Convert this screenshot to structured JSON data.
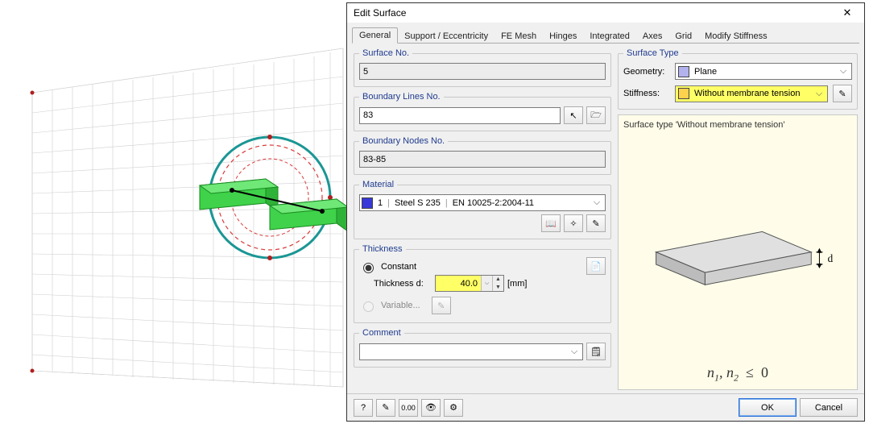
{
  "dialog": {
    "title": "Edit Surface",
    "close_glyph": "✕"
  },
  "tabs": {
    "items": [
      "General",
      "Support / Eccentricity",
      "FE Mesh",
      "Hinges",
      "Integrated",
      "Axes",
      "Grid",
      "Modify Stiffness"
    ],
    "active_index": 0
  },
  "groups": {
    "surface_no": {
      "legend": "Surface No.",
      "value": "5"
    },
    "boundary_lines": {
      "legend": "Boundary Lines No.",
      "value": "83"
    },
    "boundary_nodes": {
      "legend": "Boundary Nodes No.",
      "value": "83-85"
    },
    "material": {
      "legend": "Material",
      "index": "1",
      "name": "Steel S 235",
      "standard": "EN 10025-2:2004-11"
    },
    "thickness": {
      "legend": "Thickness",
      "constant_label": "Constant",
      "variable_label": "Variable...",
      "d_label": "Thickness d:",
      "value": "40.0",
      "unit": "[mm]"
    },
    "comment": {
      "legend": "Comment",
      "value": ""
    },
    "surface_type": {
      "legend": "Surface Type",
      "geometry_label": "Geometry:",
      "geometry_value": "Plane",
      "stiffness_label": "Stiffness:",
      "stiffness_value": "Without membrane tension"
    }
  },
  "preview": {
    "caption": "Surface type 'Without membrane tension'",
    "d_label": "d",
    "equation": {
      "n1": "n",
      "s1": "1",
      "comma": ",",
      "n2": "n",
      "s2": "2",
      "le": "≤",
      "zero": "0"
    }
  },
  "buttons": {
    "ok": "OK",
    "cancel": "Cancel"
  },
  "toolbar_icons": {
    "help": "?",
    "edit": "✎",
    "decimals": "0.00",
    "view": "👁",
    "settings": "⚙"
  },
  "small_icons": {
    "pick": "↖",
    "filter": "🗁",
    "lib": "📖",
    "new": "✧",
    "edit2": "✎",
    "opt": "📄",
    "note": "🗒"
  }
}
